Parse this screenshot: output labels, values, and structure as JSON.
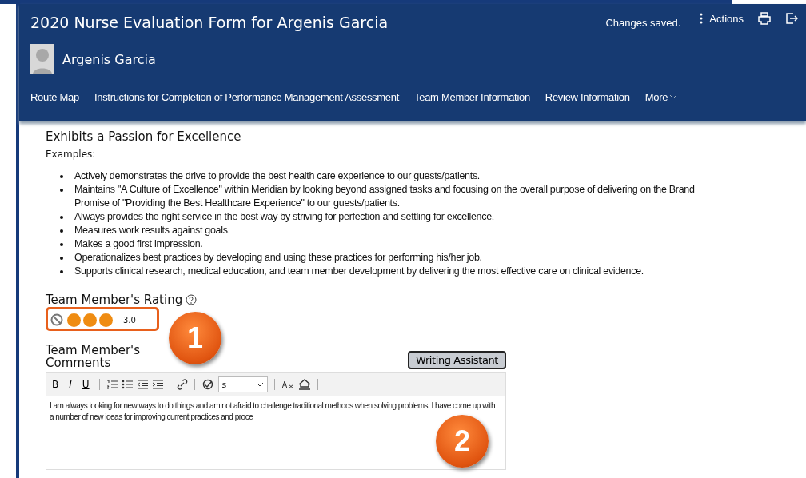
{
  "header": {
    "title": "2020 Nurse Evaluation Form for Argenis Garcia",
    "status": "Changes saved.",
    "actions": "Actions",
    "user": "Argenis Garcia"
  },
  "nav": [
    {
      "label": "Route Map",
      "kind": "link"
    },
    {
      "label": "Instructions for Completion of Performance Management Assessment",
      "kind": "link"
    },
    {
      "label": "Team Member Information",
      "kind": "link"
    },
    {
      "label": "Review Information",
      "kind": "link"
    },
    {
      "label": "More",
      "kind": "menu"
    }
  ],
  "section": {
    "title": "Exhibits a Passion for Excellence",
    "intro": "Examples:",
    "bullets": [
      "Actively demonstrates the drive to provide the best health care experience to our guests/patients.",
      "Maintains \"A Culture of Excellence\" within Meridian by looking beyond assigned tasks and focusing on the overall purpose of delivering on the Brand Promise of \"Providing the Best Healthcare Experience\" to our guests/patients.",
      "Always provides the right service in the best way by striving for perfection and settling for excellence.",
      "Measures work results against goals.",
      "Makes a good first impression.",
      "Operationalizes best practices by developing and using these practices for performing his/her job.",
      "Supports clinical research, medical education, and team member development by delivering the most effective care on clinical evidence."
    ]
  },
  "rating": {
    "label": "Team Member's Rating",
    "stars": 3,
    "value": "3.0"
  },
  "comments": {
    "label": "Team Member's Comments",
    "assistant_button": "Writing Assistant",
    "toolbar": [
      {
        "kind": "text",
        "label": "B"
      },
      {
        "kind": "text",
        "label": "I"
      },
      {
        "kind": "text",
        "label": "U"
      },
      {
        "kind": "sep"
      },
      {
        "kind": "ol"
      },
      {
        "kind": "ul"
      },
      {
        "kind": "outdent"
      },
      {
        "kind": "indent"
      },
      {
        "kind": "sep"
      },
      {
        "kind": "link"
      },
      {
        "kind": "sep"
      },
      {
        "kind": "spell"
      },
      {
        "kind": "select",
        "value": "s"
      },
      {
        "kind": "sep"
      },
      {
        "kind": "clear"
      },
      {
        "kind": "special"
      },
      {
        "kind": "sep"
      }
    ],
    "text": "I am always looking for new ways to do things and am not afraid to challenge traditional methods when solving problems. I have come up with a number of new ideas for improving current practices and proce"
  },
  "callouts": [
    "1",
    "2"
  ]
}
